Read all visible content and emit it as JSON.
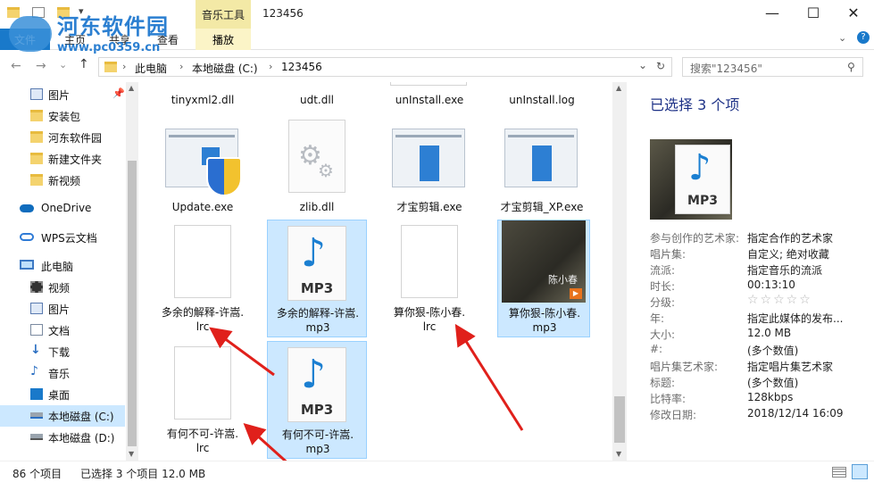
{
  "window": {
    "title": "123456",
    "ribbon_tabs": [
      "主页",
      "共享",
      "查看"
    ],
    "file_tab": "文件",
    "context_group": "音乐工具",
    "context_tab": "播放",
    "minimize": "—",
    "maximize": "☐",
    "close": "✕",
    "help": "?"
  },
  "watermark": {
    "title": "河东软件园",
    "url": "www.pc0359.cn"
  },
  "address": {
    "crumbs": [
      "此电脑",
      "本地磁盘 (C:)",
      "123456"
    ],
    "refresh": "↻",
    "dropdown": "⌄"
  },
  "search": {
    "placeholder": "搜索\"123456\""
  },
  "sidebar": {
    "items": [
      {
        "label": "图片",
        "icon": "pictures-icon",
        "pinned": true
      },
      {
        "label": "安装包",
        "icon": "folder-icon"
      },
      {
        "label": "河东软件园",
        "icon": "folder-icon"
      },
      {
        "label": "新建文件夹",
        "icon": "folder-icon"
      },
      {
        "label": "新视频",
        "icon": "folder-icon"
      },
      {
        "label": "OneDrive",
        "icon": "cloud-icon"
      },
      {
        "label": "WPS云文档",
        "icon": "wps-cloud-icon"
      },
      {
        "label": "此电脑",
        "icon": "computer-icon"
      },
      {
        "label": "视频",
        "icon": "video-icon"
      },
      {
        "label": "图片",
        "icon": "pictures-icon"
      },
      {
        "label": "文档",
        "icon": "documents-icon"
      },
      {
        "label": "下载",
        "icon": "download-icon"
      },
      {
        "label": "音乐",
        "icon": "music-icon"
      },
      {
        "label": "桌面",
        "icon": "desktop-icon"
      },
      {
        "label": "本地磁盘 (C:)",
        "icon": "drive-icon",
        "selected": true
      },
      {
        "label": "本地磁盘 (D:)",
        "icon": "drive-icon"
      }
    ]
  },
  "files": {
    "row0": [
      "tinyxml2.dll",
      "udt.dll",
      "unInstall.exe",
      "unInstall.log"
    ],
    "row1": [
      "Update.exe",
      "zlib.dll",
      "才宝剪辑.exe",
      "才宝剪辑_XP.exe"
    ],
    "row2": [
      {
        "name": "多余的解释-许嵩.lrc",
        "line1": "多余的解释-许嵩.",
        "line2": "lrc",
        "type": "lrc",
        "selected": false
      },
      {
        "name": "多余的解释-许嵩.mp3",
        "line1": "多余的解释-许嵩.",
        "line2": "mp3",
        "type": "mp3",
        "selected": true
      },
      {
        "name": "算你狠-陈小春.lrc",
        "line1": "算你狠-陈小春.",
        "line2": "lrc",
        "type": "lrc",
        "selected": false
      },
      {
        "name": "算你狠-陈小春.mp3",
        "line1": "算你狠-陈小春.",
        "line2": "mp3",
        "type": "album",
        "selected": true
      }
    ],
    "row3": [
      {
        "name": "有何不可-许嵩.lrc",
        "line1": "有何不可-许嵩.",
        "line2": "lrc",
        "type": "lrc",
        "selected": false
      },
      {
        "name": "有何不可-许嵩.mp3",
        "line1": "有何不可-许嵩.",
        "line2": "mp3",
        "type": "mp3",
        "selected": true
      }
    ],
    "mp3_label": "MP3",
    "album_text": "陈小春"
  },
  "details": {
    "title": "已选择 3 个项",
    "mp3_label": "MP3",
    "props": [
      {
        "k": "参与创作的艺术家:",
        "v": "指定合作的艺术家"
      },
      {
        "k": "唱片集:",
        "v": "自定义; 绝对收藏"
      },
      {
        "k": "流派:",
        "v": "指定音乐的流派"
      },
      {
        "k": "时长:",
        "v": "00:13:10"
      },
      {
        "k": "分级:",
        "v": "☆☆☆☆☆"
      },
      {
        "k": "年:",
        "v": "指定此媒体的发布..."
      },
      {
        "k": "大小:",
        "v": "12.0 MB"
      },
      {
        "k": "#:",
        "v": "(多个数值)"
      },
      {
        "k": "唱片集艺术家:",
        "v": "指定唱片集艺术家"
      },
      {
        "k": "标题:",
        "v": "(多个数值)"
      },
      {
        "k": "比特率:",
        "v": "128kbps"
      },
      {
        "k": "修改日期:",
        "v": "2018/12/14 16:09"
      }
    ]
  },
  "status": {
    "count": "86 个项目",
    "selected": "已选择 3 个项目  12.0 MB"
  },
  "colors": {
    "accent": "#0078d7",
    "selection": "#cce8ff",
    "arrow": "#e0201b",
    "context_tab": "#f3e9a6"
  }
}
